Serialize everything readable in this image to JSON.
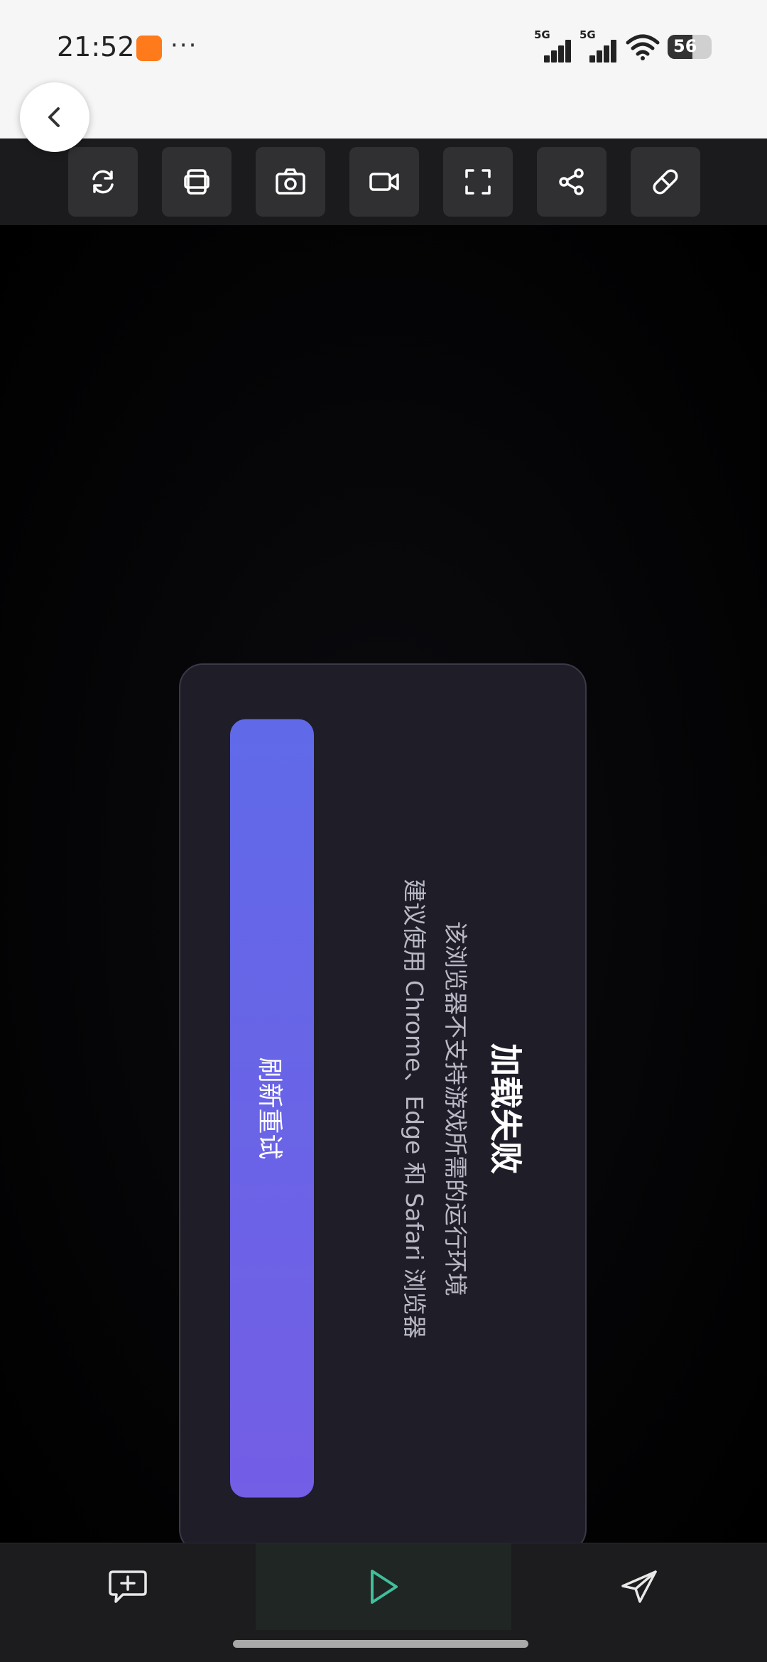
{
  "status_bar": {
    "time": "21:52",
    "more_dots": "···",
    "signal_1_label": "5G",
    "signal_2_label": "5G",
    "battery_level": "56"
  },
  "toolbar": {
    "icons": [
      "refresh-icon",
      "copy-icon",
      "screenshot-icon",
      "video-record-icon",
      "fullscreen-icon",
      "share-icon",
      "link-icon"
    ]
  },
  "dialog": {
    "title": "加载失败",
    "message_line_1": "该浏览器不支持游戏所需的运行环境",
    "message_line_2": "建议使用 Chrome、Edge 和 Safari 浏览器",
    "refresh_button_label": "刷新重试",
    "button_colors": [
      "#606ae8",
      "#735ee6"
    ]
  },
  "bottom_bar": {
    "icons": [
      "comment-add-icon",
      "play-icon",
      "send-icon"
    ],
    "accent_color": "#3fbf9a"
  }
}
